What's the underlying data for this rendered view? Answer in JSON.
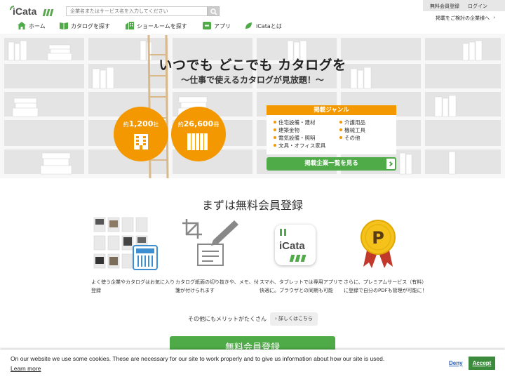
{
  "header": {
    "logo_text": "iCata",
    "search_placeholder": "企業名またはサービス名を入力してください",
    "register_link": "無料会員登録",
    "login_link": "ログイン",
    "advertise_link": "掲載をご検討の企業様へ",
    "advertise_arrow": "›"
  },
  "nav": {
    "items": [
      {
        "label": "ホーム",
        "icon": "home-icon"
      },
      {
        "label": "カタログを探す",
        "icon": "book-icon"
      },
      {
        "label": "ショールームを探す",
        "icon": "building-icon"
      },
      {
        "label": "アプリ",
        "icon": "app-icon"
      },
      {
        "label": "iCataとは",
        "icon": "leaf-icon"
      }
    ]
  },
  "hero": {
    "title": "いつでも どこでも カタログを",
    "subtitle": "〜仕事で使えるカタログが見放題！〜",
    "companies_prefix": "約",
    "companies_count": "1,200",
    "companies_unit": "社",
    "catalogs_prefix": "約",
    "catalogs_count": "26,600",
    "catalogs_unit": "冊",
    "genre_title": "掲載ジャンル",
    "genres_left": [
      "住宅設備・建材",
      "建築金物",
      "電気設備・照明",
      "文具・オフィス家具"
    ],
    "genres_right": [
      "介護用品",
      "機械工具",
      "その他"
    ],
    "list_button": "掲載企業一覧を見る",
    "accent_color": "#f39800"
  },
  "registration": {
    "title": "まずは無料会員登録",
    "features": [
      {
        "icon": "catalog-grid-icon",
        "text": "よく使う企業やカタログはお気に入り登録"
      },
      {
        "icon": "crop-pen-icon",
        "text": "カタログ紙面の切り抜きや、メモ、付箋が付けられます"
      },
      {
        "icon": "icata-app-icon",
        "text": "スマホ、タブレットでは専用アプリで快適に。ブラウザとの同期も可能"
      },
      {
        "icon": "premium-badge-icon",
        "text": "さらに、プレミアムサービス（有料）に登録で自分のPDFも管理が可能に！"
      }
    ],
    "app_icon_text": "iCata",
    "merit_text": "その他にもメリットがたくさん",
    "merit_button": "› 詳しくはこちら",
    "free_register_button": "無料会員登録",
    "brand_color": "#4eab47"
  },
  "cookie": {
    "message": "On our website we use some cookies. These are necessary for our site to work properly and to give us information about how our site is used.",
    "learn_more": "Learn more",
    "deny": "Deny",
    "accept": "Accept"
  }
}
